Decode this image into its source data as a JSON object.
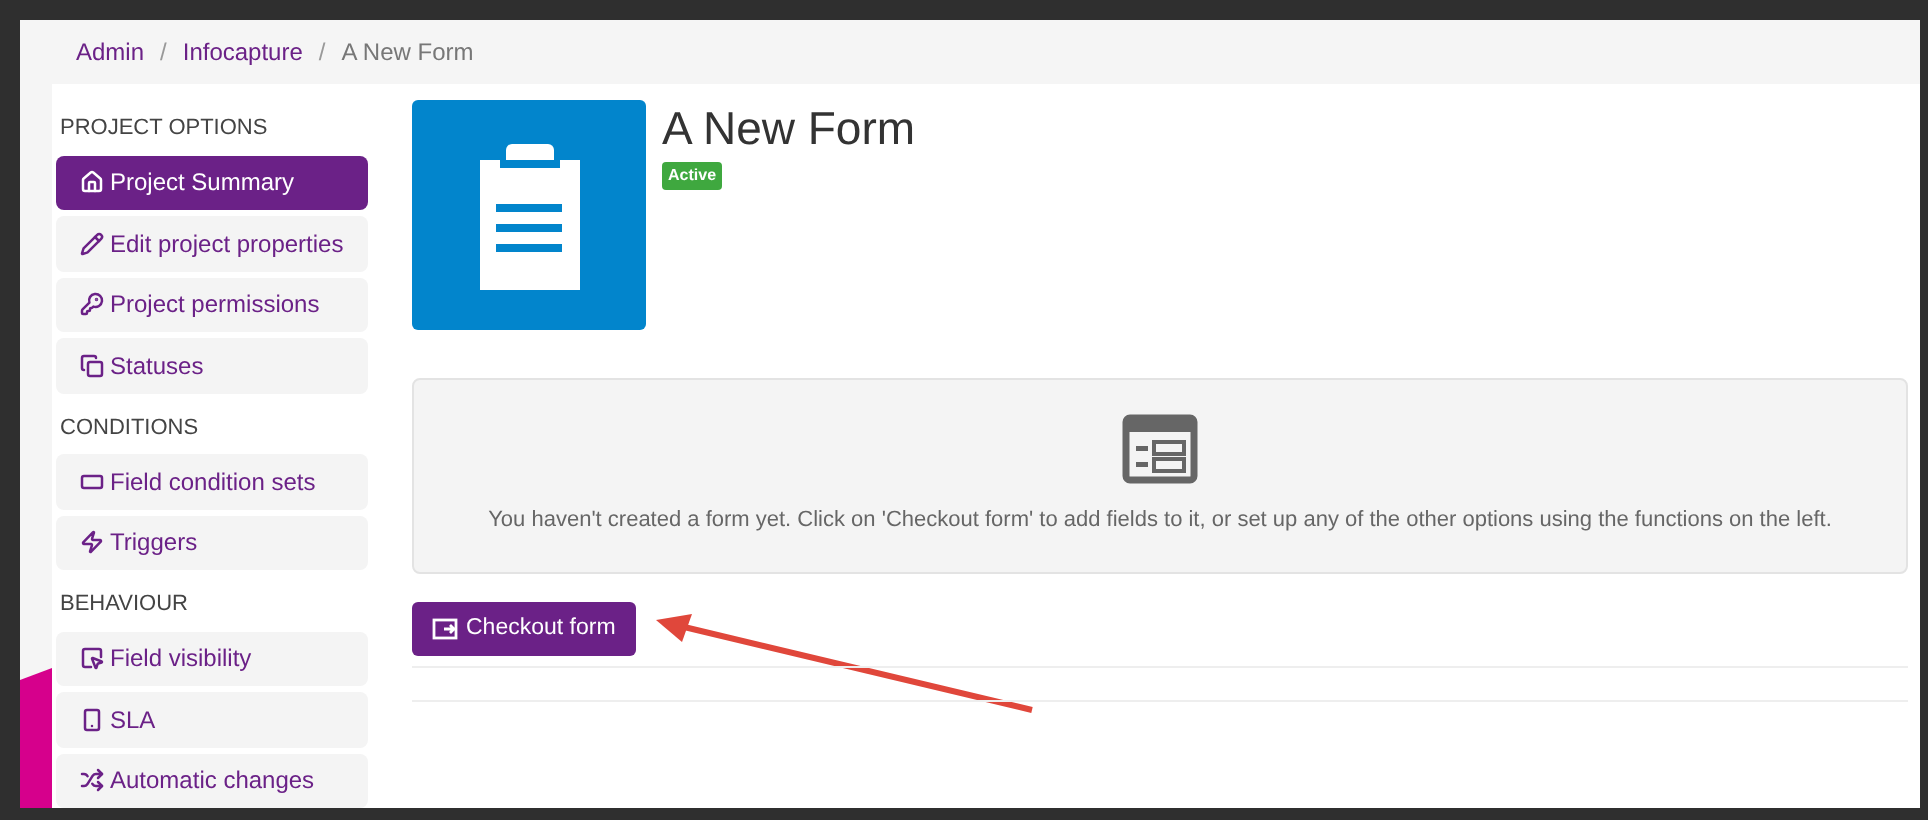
{
  "breadcrumb": [
    {
      "label": "Admin",
      "kind": "link"
    },
    {
      "label": "/",
      "kind": "separator"
    },
    {
      "label": "Infocapture",
      "kind": "link"
    },
    {
      "label": "/",
      "kind": "separator"
    },
    {
      "label": "A New Form",
      "kind": "current"
    }
  ],
  "sidebar": {
    "items": [
      {
        "kind": "section",
        "label": "PROJECT OPTIONS"
      },
      {
        "kind": "item",
        "label": "Project Summary",
        "selected": true
      },
      {
        "kind": "item",
        "label": "Edit project properties",
        "selected": false
      },
      {
        "kind": "item",
        "label": "Project permissions",
        "selected": false
      },
      {
        "kind": "item",
        "label": "Statuses",
        "selected": false
      },
      {
        "kind": "section",
        "label": "CONDITIONS"
      },
      {
        "kind": "item",
        "label": "Field condition sets",
        "selected": false
      },
      {
        "kind": "item",
        "label": "Triggers",
        "selected": false
      },
      {
        "kind": "section",
        "label": "BEHAVIOUR"
      },
      {
        "kind": "item",
        "label": "Field visibility",
        "selected": false
      },
      {
        "kind": "item",
        "label": "SLA",
        "selected": false
      },
      {
        "kind": "item",
        "label": "Automatic changes",
        "selected": false
      }
    ]
  },
  "form": {
    "title": "A New Form",
    "status": "Active"
  },
  "empty_state": {
    "message": "You haven't created a form yet. Click on 'Checkout form' to add fields to it, or set up any of the other options using the functions on the left."
  },
  "checkout_button": {
    "label": "Checkout form"
  }
}
